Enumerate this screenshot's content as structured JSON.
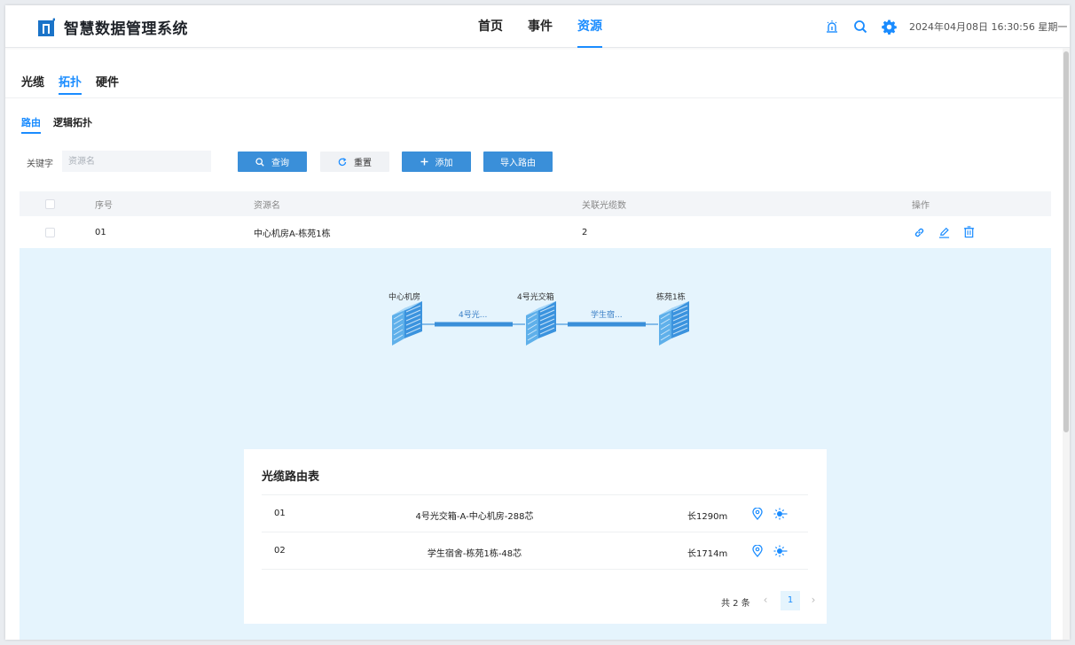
{
  "header": {
    "app_title": "智慧数据管理系统",
    "nav": [
      {
        "label": "首页",
        "active": false
      },
      {
        "label": "事件",
        "active": false
      },
      {
        "label": "资源",
        "active": true
      }
    ],
    "icons": [
      "alarm-icon",
      "search-icon",
      "gear-icon"
    ],
    "datetime": "2024年04月08日 16:30:56 星期一"
  },
  "tabs_level1": [
    {
      "label": "光缆",
      "active": false
    },
    {
      "label": "拓扑",
      "active": true
    },
    {
      "label": "硬件",
      "active": false
    }
  ],
  "tabs_level2": [
    {
      "label": "路由",
      "active": true
    },
    {
      "label": "逻辑拓扑",
      "active": false
    }
  ],
  "filter": {
    "keyword_label": "关键字",
    "keyword_placeholder": "资源名",
    "keyword_value": "",
    "query_label": "查询",
    "reset_label": "重置",
    "add_label": "添加",
    "import_label": "导入路由"
  },
  "table": {
    "columns": [
      "序号",
      "资源名",
      "关联光缆数",
      "操作"
    ],
    "rows": [
      {
        "index": "01",
        "name": "中心机房A-栋苑1栋",
        "cable_count": "2"
      }
    ]
  },
  "topology": {
    "nodes": [
      "中心机房",
      "4号光交箱",
      "栋苑1栋"
    ],
    "links": [
      "4号光...",
      "学生宿..."
    ]
  },
  "route_table": {
    "title": "光缆路由表",
    "rows": [
      {
        "index": "01",
        "name": "4号光交箱-A-中心机房-288芯",
        "length": "长1290m"
      },
      {
        "index": "02",
        "name": "学生宿舍-栋苑1栋-48芯",
        "length": "长1714m"
      }
    ],
    "pager": {
      "total": "共 2 条",
      "current_page": "1"
    }
  },
  "colors": {
    "accent": "#1a8cff",
    "button_primary": "#3a8fd9",
    "expand_bg": "#e5f4fd"
  }
}
